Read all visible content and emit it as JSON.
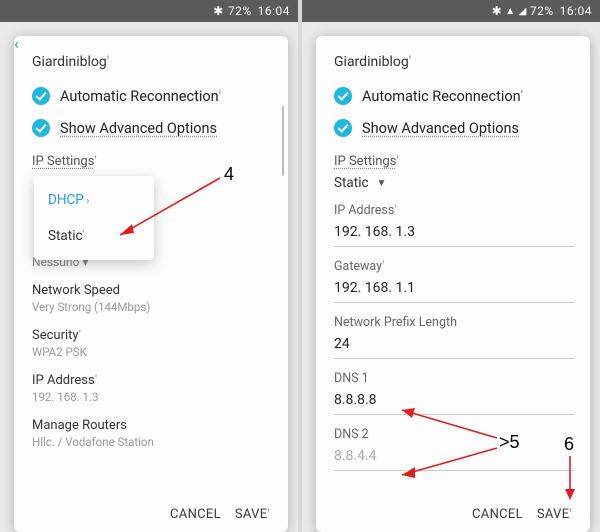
{
  "statusbar": {
    "left_battery": "72%",
    "left_time": "16:04",
    "right_battery": "72%",
    "right_time": "16:04"
  },
  "wifi_name": "Giardiniblog",
  "checks": {
    "auto_reconnect": "Automatic Reconnection",
    "show_advanced": "Show Advanced Options"
  },
  "ip_settings_label": "IP Settings",
  "left": {
    "dropdown": {
      "dhcp": "DHCP",
      "static": "Static"
    },
    "remnant": "Nessuno",
    "network_speed": {
      "title": "Network Speed",
      "sub": "Very Strong (144Mbps)"
    },
    "security": {
      "title": "Security",
      "sub": "WPA2 PSK"
    },
    "ip_address": {
      "title": "IP Address",
      "sub": "192. 168. 1.3"
    },
    "manage_routers": {
      "title": "Manage Routers",
      "sub": "Hllc. / Vodafone Station"
    }
  },
  "right": {
    "selected": "Static",
    "fields": {
      "ip_label": "IP Address",
      "ip_value": "192. 168. 1.3",
      "gateway_label": "Gateway",
      "gateway_value": "192. 168. 1.1",
      "prefix_label": "Network Prefix Length",
      "prefix_value": "24",
      "dns1_label": "DNS 1",
      "dns1_value": "8.8.8.8",
      "dns2_label": "DNS 2",
      "dns2_value": "8.8.4.4"
    }
  },
  "actions": {
    "cancel": "CANCEL",
    "save": "SAVE"
  },
  "annotations": {
    "n4": "4",
    "n5": ">5",
    "n6": "6"
  }
}
